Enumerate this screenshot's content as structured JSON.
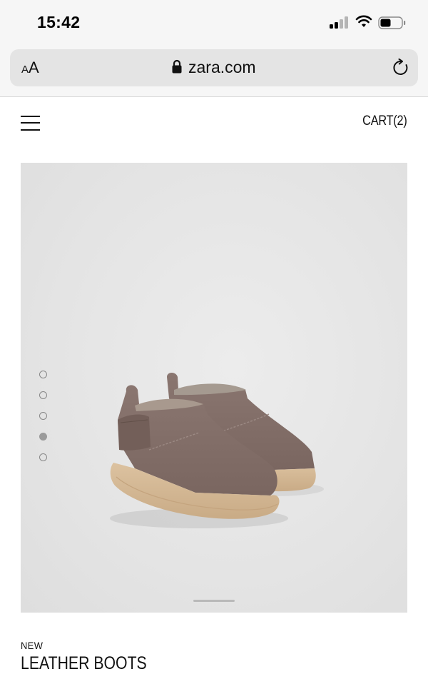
{
  "status_bar": {
    "time": "15:42"
  },
  "browser": {
    "text_size_small": "A",
    "text_size_large": "A",
    "url": "zara.com",
    "icons": [
      "signal-icon",
      "wifi-icon",
      "battery-icon",
      "lock-icon",
      "reload-icon"
    ]
  },
  "header": {
    "menu_icon": "hamburger-menu-icon",
    "cart_label": "CART(2)"
  },
  "gallery": {
    "image_count": 5,
    "active_index": 4
  },
  "product": {
    "badge": "NEW",
    "name": "LEATHER BOOTS"
  }
}
